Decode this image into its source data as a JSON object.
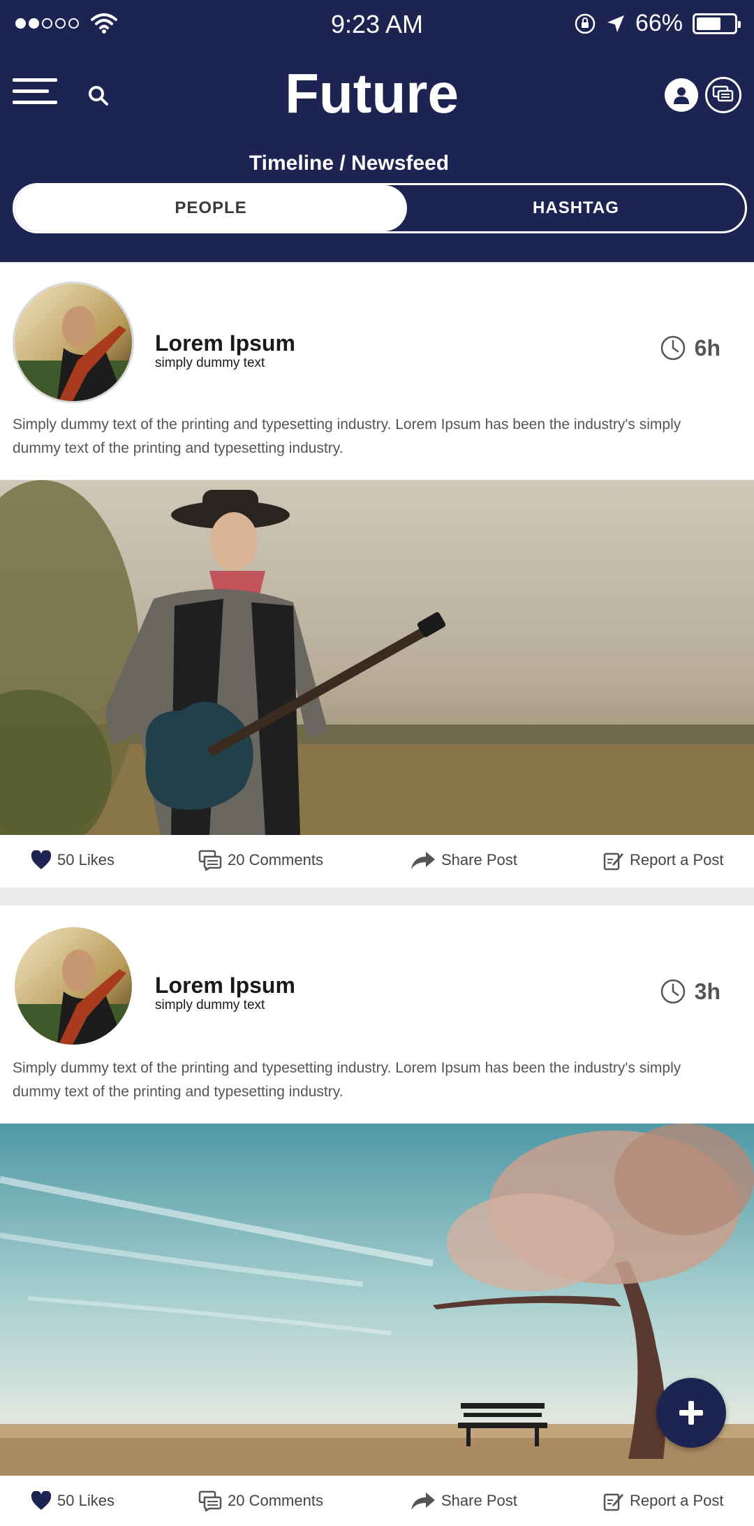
{
  "status_bar": {
    "time": "9:23 AM",
    "battery_percent": "66%",
    "battery_level": 0.66,
    "signal_bars": 2
  },
  "header": {
    "title": "Future",
    "subtitle": "Timeline / Newsfeed",
    "background_color": "#1e2452",
    "icons": [
      "menu-icon",
      "search-icon",
      "profile-icon",
      "chat-icon"
    ]
  },
  "tabs": [
    {
      "label": "PEOPLE",
      "active": true
    },
    {
      "label": "HASHTAG",
      "active": false
    }
  ],
  "posts": [
    {
      "author": "Lorem Ipsum",
      "subtitle": "simply dummy text",
      "time": "6h",
      "text": "Simply dummy text of the printing and typesetting industry. Lorem Ipsum has been the industry's simply dummy text of the printing and typesetting industry.",
      "image": "guitarist-photo",
      "actions": {
        "likes": "50 Likes",
        "comments": "20 Comments",
        "share": "Share Post",
        "report": "Report a Post"
      }
    },
    {
      "author": "Lorem Ipsum",
      "subtitle": "simply dummy text",
      "time": "3h",
      "text": "Simply dummy text of the printing and typesetting industry. Lorem Ipsum has been the industry's simply dummy text of the printing and typesetting industry.",
      "image": "tree-bench-photo",
      "actions": {
        "likes": "50 Likes",
        "comments": "20 Comments",
        "share": "Share Post",
        "report": "Report a Post"
      }
    }
  ],
  "fab": {
    "icon": "plus-icon"
  }
}
